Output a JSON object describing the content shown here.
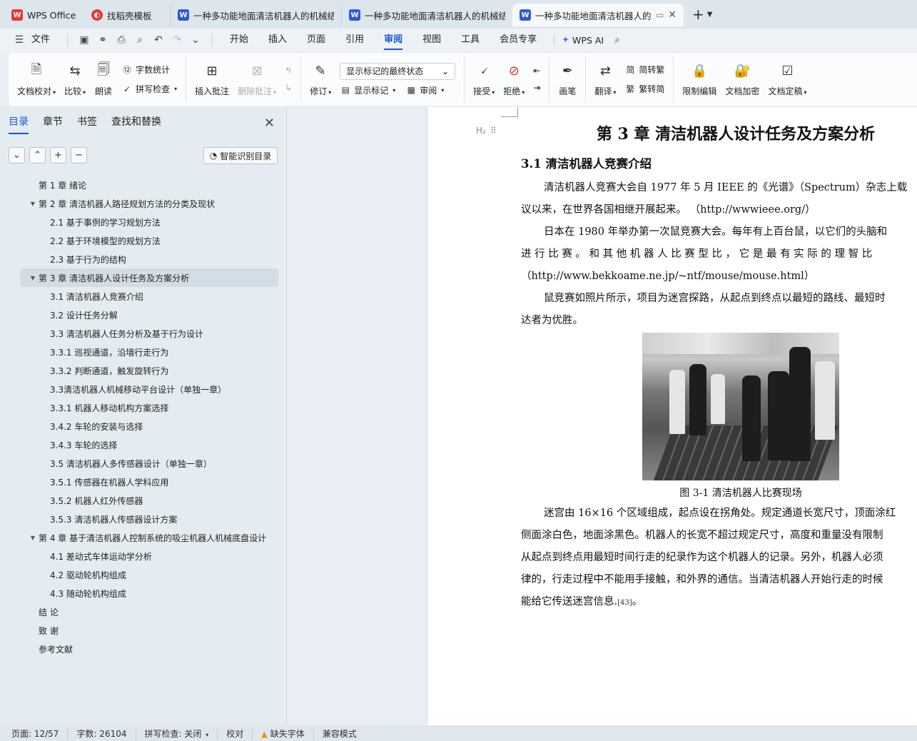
{
  "tabs": [
    {
      "label": "WPS Office",
      "icon": "wps-logo-icon",
      "active": false
    },
    {
      "label": "找稻壳模板",
      "icon": "daoke-logo-icon",
      "active": false
    },
    {
      "label": "一种多功能地面清洁机器人的机械结",
      "icon": "word-doc-icon",
      "active": false
    },
    {
      "label": "一种多功能地面清洁机器人的机械结",
      "icon": "word-doc-icon",
      "active": false
    },
    {
      "label": "一种多功能地面清洁机器人的",
      "icon": "word-doc-icon",
      "active": true
    }
  ],
  "menubar": {
    "file_label": "文件",
    "items": [
      "开始",
      "插入",
      "页面",
      "引用",
      "审阅",
      "视图",
      "工具",
      "会员专享"
    ],
    "active": "审阅",
    "ai_label": "WPS AI"
  },
  "ribbon": {
    "doc_check": "文档校对",
    "compare": "比较",
    "read_aloud": "朗读",
    "word_count": "字数统计",
    "spell_check": "拼写检查",
    "insert_comment": "插入批注",
    "delete_comment": "删除批注",
    "revise": "修订",
    "markup_dropdown": "显示标记的最终状态",
    "show_markup": "显示标记",
    "review": "审阅",
    "accept": "接受",
    "reject": "拒绝",
    "pen": "画笔",
    "translate": "翻译",
    "to_traditional": "简转繁",
    "to_simplified": "繁转简",
    "restrict_edit": "限制编辑",
    "encrypt": "文档加密",
    "finalize": "文档定稿"
  },
  "nav": {
    "tabs": [
      "目录",
      "章节",
      "书签",
      "查找和替换"
    ],
    "active_tab": "目录",
    "smart_toc": "智能识别目录",
    "toc": [
      {
        "text": "第 1 章   绪论",
        "level": 1,
        "arrow": false
      },
      {
        "text": "第 2 章   清洁机器人路径规划方法的分类及现状",
        "level": 1,
        "arrow": true
      },
      {
        "text": "2.1  基于事例的学习规划方法",
        "level": 2,
        "arrow": false
      },
      {
        "text": "2.2  基于环境模型的规划方法",
        "level": 2,
        "arrow": false
      },
      {
        "text": "2.3  基于行为的结构",
        "level": 2,
        "arrow": false
      },
      {
        "text": "第 3 章  清洁机器人设计任务及方案分析",
        "level": 1,
        "arrow": true,
        "selected": true
      },
      {
        "text": "3.1  清洁机器人竞赛介绍",
        "level": 2,
        "arrow": false
      },
      {
        "text": "3.2  设计任务分解",
        "level": 2,
        "arrow": false
      },
      {
        "text": "3.3  清洁机器人任务分析及基于行为设计",
        "level": 2,
        "arrow": false
      },
      {
        "text": "3.3.1  巡视通道，沿墙行走行为",
        "level": 2,
        "arrow": false
      },
      {
        "text": "3.3.2  判断通道，触发旋转行为",
        "level": 2,
        "arrow": false
      },
      {
        "text": "3.3清洁机器人机械移动平台设计（单独一章）",
        "level": 2,
        "arrow": false
      },
      {
        "text": "3.3.1  机器人移动机构方案选择",
        "level": 2,
        "arrow": false
      },
      {
        "text": "3.4.2  车轮的安装与选择",
        "level": 2,
        "arrow": false
      },
      {
        "text": "3.4.3  车轮的选择",
        "level": 2,
        "arrow": false
      },
      {
        "text": "3.5  清洁机器人多传感器设计（单独一章）",
        "level": 2,
        "arrow": false
      },
      {
        "text": "3.5.1  传感器在机器人学科应用",
        "level": 2,
        "arrow": false
      },
      {
        "text": "3.5.2  机器人红外传感器",
        "level": 2,
        "arrow": false
      },
      {
        "text": "3.5.3 清洁机器人传感器设计方案",
        "level": 2,
        "arrow": false
      },
      {
        "text": "第 4 章  基于清洁机器人控制系统的吸尘机器人机械底盘设计",
        "level": 1,
        "arrow": true
      },
      {
        "text": "4.1 差动式车体运动学分析",
        "level": 2,
        "arrow": false
      },
      {
        "text": "4.2  驱动轮机构组成",
        "level": 2,
        "arrow": false
      },
      {
        "text": "4.3  随动轮机构组成",
        "level": 2,
        "arrow": false
      },
      {
        "text": "结  论",
        "level": 1,
        "arrow": false
      },
      {
        "text": "致  谢",
        "level": 1,
        "arrow": false
      },
      {
        "text": "参考文献",
        "level": 1,
        "arrow": false
      }
    ]
  },
  "doc": {
    "heading_marker": "H₂",
    "chapter_title": "第 3 章  清洁机器人设计任务及方案分析",
    "section_title": "3.1  清洁机器人竞赛介绍",
    "paragraphs": [
      "清洁机器人竞赛大会自 1977 年 5 月 IEEE 的《光谱》（Spectrum）杂志上载",
      "议以来，在世界各国相继开展起来。 （http://wwwieee.org/）",
      "日本在 1980 年举办第一次鼠竞赛大会。每年有上百台鼠，以它们的头脑和",
      "进 行 比 赛 。 和 其 他 机 器 人 比 赛 型 比 ， 它 是 最 有 实 际 的 理 智 比",
      "（http://www.bekkoame.ne.jp/~ntf/mouse/mouse.html）",
      "鼠竞赛如照片所示，项目为迷宫探路，从起点到终点以最短的路线、最短时",
      "达者为优胜。"
    ],
    "figure_caption": "图 3-1  清洁机器人比赛现场",
    "paragraphs2": [
      "迷宫由 16×16 个区域组成，起点设在拐角处。规定通道长宽尺寸，顶面涂红",
      "侧面涂白色，地面涂黑色。机器人的长宽不超过规定尺寸，高度和重量没有限制",
      "从起点到终点用最短时间行走的纪录作为这个机器人的记录。另外，机器人必须",
      "律的，行走过程中不能用手接触，和外界的通信。当清洁机器人开始行走的时候",
      "能给它传送迷宫信息."
    ],
    "citation": "[43]",
    "end_punct": "。"
  },
  "status": {
    "page": "页面: 12/57",
    "words": "字数: 26104",
    "spell": "拼写检查: 关闭",
    "proof": "校对",
    "missing_font": "缺失字体",
    "compat": "兼容模式"
  },
  "colors": {
    "accent": "#1a56db",
    "selected_row": "#d3dde5"
  }
}
